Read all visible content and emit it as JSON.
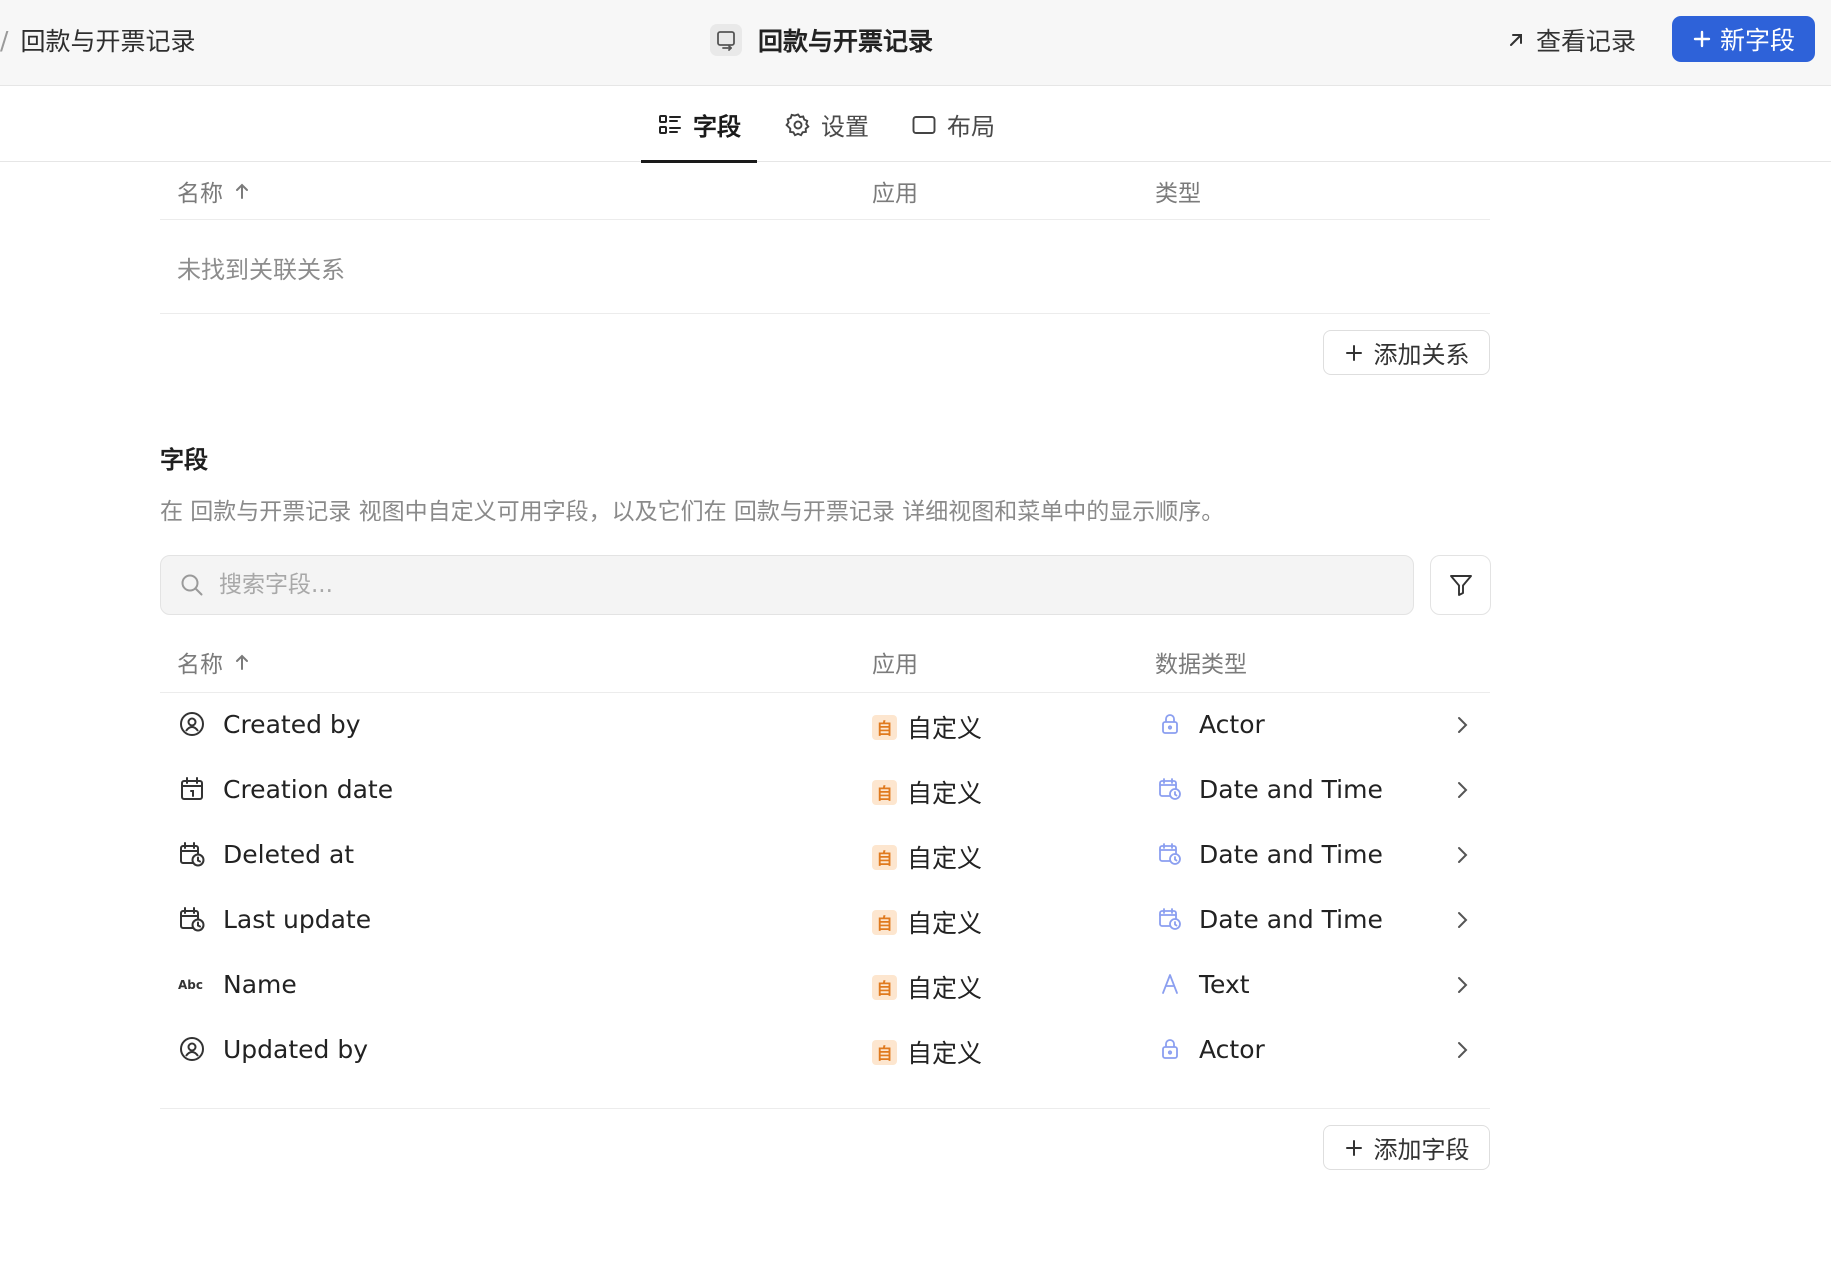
{
  "header": {
    "breadcrumb_sep": "/",
    "breadcrumb": "回款与开票记录",
    "title": "回款与开票记录",
    "view_records": "查看记录",
    "new_field": "新字段"
  },
  "tabs": [
    {
      "label": "字段",
      "icon": "list-icon",
      "active": true
    },
    {
      "label": "设置",
      "icon": "gear-icon",
      "active": false
    },
    {
      "label": "布局",
      "icon": "layout-icon",
      "active": false
    }
  ],
  "relations": {
    "col_name": "名称",
    "col_app": "应用",
    "col_type": "类型",
    "empty_text": "未找到关联关系",
    "add_label": "添加关系"
  },
  "fields_section": {
    "title": "字段",
    "description": "在 回款与开票记录 视图中自定义可用字段，以及它们在 回款与开票记录 详细视图和菜单中的显示顺序。",
    "search_placeholder": "搜索字段...",
    "col_name": "名称",
    "col_app": "应用",
    "col_type": "数据类型",
    "add_label": "添加字段"
  },
  "fields": [
    {
      "name": "Created by",
      "icon": "user-circle-icon",
      "app_badge": "自",
      "app": "自定义",
      "type": "Actor",
      "type_icon": "lock-icon"
    },
    {
      "name": "Creation date",
      "icon": "calendar-icon",
      "app_badge": "自",
      "app": "自定义",
      "type": "Date and Time",
      "type_icon": "calendar-clock-icon"
    },
    {
      "name": "Deleted at",
      "icon": "calendar-clock-icon",
      "app_badge": "自",
      "app": "自定义",
      "type": "Date and Time",
      "type_icon": "calendar-clock-icon"
    },
    {
      "name": "Last update",
      "icon": "calendar-clock-icon",
      "app_badge": "自",
      "app": "自定义",
      "type": "Date and Time",
      "type_icon": "calendar-clock-icon"
    },
    {
      "name": "Name",
      "icon": "abc-text-icon",
      "app_badge": "自",
      "app": "自定义",
      "type": "Text",
      "type_icon": "letter-a-icon"
    },
    {
      "name": "Updated by",
      "icon": "user-circle-icon",
      "app_badge": "自",
      "app": "自定义",
      "type": "Actor",
      "type_icon": "lock-icon"
    }
  ],
  "colors": {
    "primary": "#2e62d9",
    "badge_bg": "#fde6cf",
    "badge_fg": "#e07a1f",
    "type_icon": "#8b9ff0"
  }
}
